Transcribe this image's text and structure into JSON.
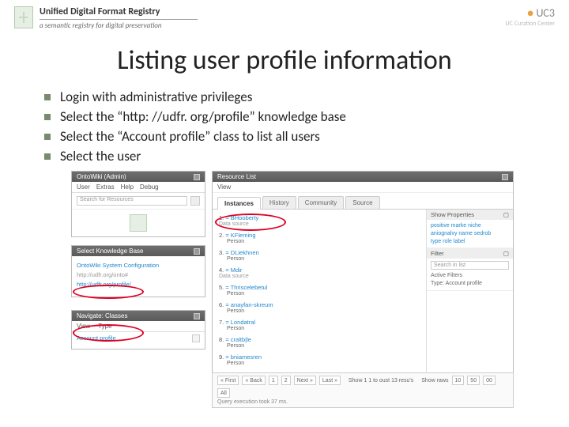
{
  "header": {
    "title": "Unified Digital Format Registry",
    "subtitle": "a semantic registry for digital preservation",
    "uc3_label": "UC3",
    "uc3_sub": "UC Curation Center"
  },
  "slide_title": "Listing user profile information",
  "bullets": [
    "Login with administrative privileges",
    "Select the “http: //udfr. org/profile” knowledge base",
    "Select the “Account profile” class to list all users",
    "Select the user"
  ],
  "ontowiki": {
    "panel_title": "OntoWiki (Admin)",
    "menu": [
      "User",
      "Extras",
      "Help",
      "Debug"
    ],
    "search_placeholder": "Search for Resources"
  },
  "kb": {
    "panel_title": "Select Knowledge Base",
    "items": [
      {
        "label": "OntoWiki System Configuration",
        "cls": "kb-line"
      },
      {
        "label": "http://udfr.org/onto#",
        "cls": "kb-line muted"
      },
      {
        "label": "http://udfr.org/profile/",
        "cls": "kb-line"
      }
    ]
  },
  "nav": {
    "panel_title": "Navigate: Classes",
    "tabs": [
      "View",
      "Type"
    ],
    "item": "Account profile"
  },
  "resource": {
    "panel_title": "Resource List",
    "view_label": "View",
    "tabs": [
      "Instances",
      "History",
      "Community",
      "Source"
    ],
    "items": [
      {
        "n": "1.",
        "name": "= BHooberty",
        "ds": "Data source"
      },
      {
        "n": "2.",
        "name": "= KFleming",
        "sub": "Person"
      },
      {
        "n": "3.",
        "name": "= DLiekhnen",
        "sub": "Person"
      },
      {
        "n": "4.",
        "name": "= Mdir",
        "ds": "Data source"
      },
      {
        "n": "5.",
        "name": "= Thriscelebetul",
        "sub": "Person"
      },
      {
        "n": "6.",
        "name": "= anayfan-skreum",
        "sub": "Person"
      },
      {
        "n": "7.",
        "name": "= Londatral",
        "sub": "Person"
      },
      {
        "n": "8.",
        "name": "= craltb|le",
        "sub": "Person"
      },
      {
        "n": "9.",
        "name": "= bniamesren",
        "sub": "Person"
      }
    ],
    "side": {
      "props_title": "Show Properties",
      "props_body": "positive  marke  niche\naniognalvy  name  sedrob\ntype  role label",
      "filter_title": "Filter",
      "filter_placeholder": "Search in list",
      "filter_info1": "Active Filters",
      "filter_info2": "Type: Account profile"
    }
  },
  "pager": {
    "buttons": [
      "« First",
      "« Back",
      "1",
      "2",
      "Next »",
      "Last »"
    ],
    "status": "Show 1 1 to oust 13 resu's",
    "limit_label": "Show raws",
    "limits": [
      "10",
      "50",
      "00",
      "All"
    ],
    "query": "Query execution took 37 ms."
  }
}
